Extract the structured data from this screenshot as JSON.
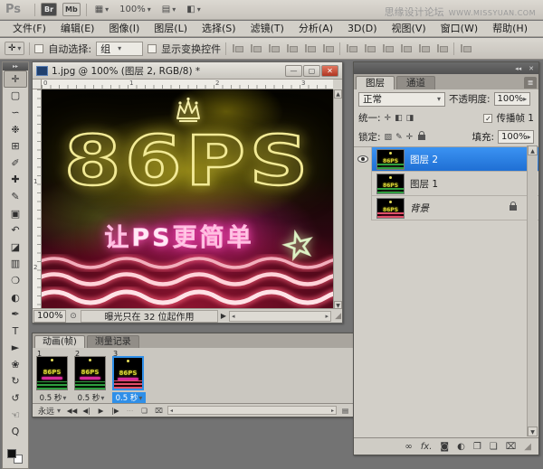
{
  "app_bar": {
    "logo": "Ps",
    "bridge": "Br",
    "mini_bridge": "Mb",
    "zoom_level": "100%",
    "watermark_cn": "思缘设计论坛",
    "watermark_en": "WWW.MISSYUAN.COM"
  },
  "menu": {
    "items": [
      "文件(F)",
      "编辑(E)",
      "图像(I)",
      "图层(L)",
      "选择(S)",
      "滤镜(T)",
      "分析(A)",
      "3D(D)",
      "视图(V)",
      "窗口(W)",
      "帮助(H)"
    ]
  },
  "options": {
    "auto_select_label": "自动选择:",
    "auto_select_value": "组",
    "show_transform_label": "显示变换控件"
  },
  "tools": {
    "glyphs": [
      "✛",
      "▢",
      "∽",
      "❉",
      "⊞",
      "✐",
      "✚",
      "✎",
      "▣",
      "↶",
      "◪",
      "▥",
      "❍",
      "◐",
      "✒",
      "T",
      "►",
      "❀",
      "↻",
      "↺",
      "☜",
      "Q"
    ]
  },
  "document": {
    "title": "1.jpg @ 100% (图层 2, RGB/8) *",
    "ruler_top": [
      "0",
      "1",
      "2",
      "3"
    ],
    "ruler_left": [
      "1",
      "2"
    ],
    "status_zoom": "100%",
    "status_text": "曝光只在 32 位起作用",
    "canvas": {
      "headline": "86PS",
      "subline": "让PS更简单",
      "star": "☆"
    }
  },
  "animation": {
    "tab_frames": "动画(帧)",
    "tab_measure": "测量记录",
    "frames": [
      {
        "number": "1",
        "duration": "0.5 秒"
      },
      {
        "number": "2",
        "duration": "0.5 秒"
      },
      {
        "number": "3",
        "duration": "0.5 秒"
      }
    ],
    "loop_value": "永远"
  },
  "layers": {
    "tab_layers": "图层",
    "tab_channels": "通道",
    "blend_mode": "正常",
    "opacity_label": "不透明度:",
    "opacity_value": "100%",
    "unify_label": "统一:",
    "propagate_label": "传播帧 1",
    "lock_label": "锁定:",
    "fill_label": "填充:",
    "fill_value": "100%",
    "items": [
      {
        "name": "图层 2"
      },
      {
        "name": "图层 1"
      },
      {
        "name": "背景"
      }
    ]
  },
  "icons": {
    "expand": "▸▸",
    "collapse": "◂◂",
    "close": "✕",
    "minimize": "—",
    "maximize": "▢",
    "chevron_down": "▾",
    "chevron_right": "▸",
    "chevron_left": "◂",
    "up": "▲",
    "down": "▼",
    "panel_menu": "≣",
    "check": "✓",
    "rewind": "◀◀",
    "prev_frame": "◀|",
    "play": "▶",
    "next_frame": "|▶",
    "tween": "⋯",
    "new_item": "❏",
    "group_folder": "❐",
    "trash": "⌧",
    "link": "∞",
    "fx": "fx.",
    "mask": "◙",
    "adjust": "◐",
    "checker": "▨",
    "brush_small": "✎",
    "move_small": "✛",
    "unify_b": "◧",
    "unify_c": "◨",
    "arrange": "▦",
    "view": "▤",
    "screen_mode": "◧",
    "status_badge": "⊙",
    "grip": "◢",
    "convert": "▤"
  }
}
